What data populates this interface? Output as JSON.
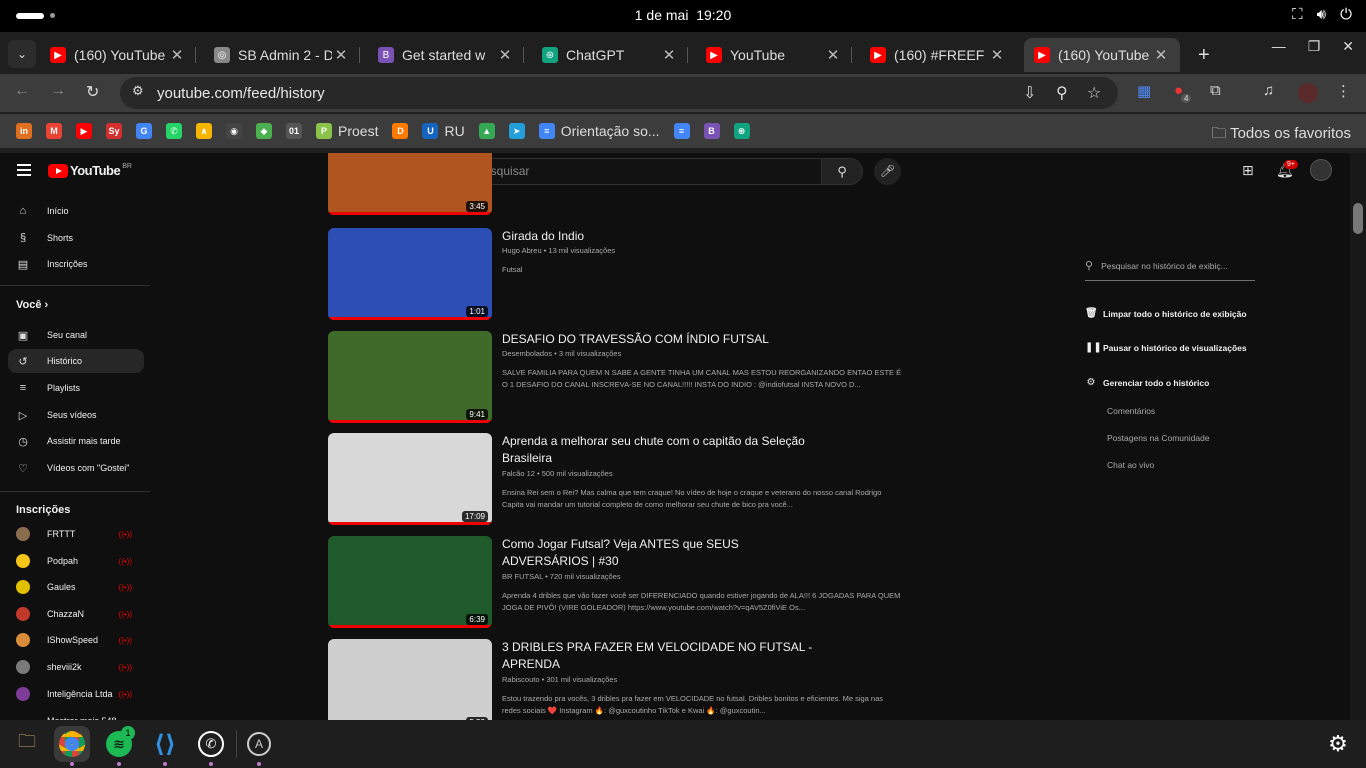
{
  "system": {
    "date": "1 de mai",
    "time": "19:20"
  },
  "tabs": [
    {
      "title": "(160) YouTube",
      "icon": "youtube-icon",
      "color": "#ff0000"
    },
    {
      "title": "SB Admin 2 - D",
      "icon": "globe-icon",
      "color": "#888888"
    },
    {
      "title": "Get started w",
      "icon": "bootstrap-icon",
      "color": "#7952b3"
    },
    {
      "title": "ChatGPT",
      "icon": "chatgpt-icon",
      "color": "#10a37f"
    },
    {
      "title": "YouTube",
      "icon": "youtube-icon",
      "color": "#ff0000"
    },
    {
      "title": "(160) #FREEF",
      "icon": "youtube-icon",
      "color": "#ff0000"
    },
    {
      "title": "(160) YouTube",
      "icon": "youtube-icon",
      "color": "#ff0000"
    }
  ],
  "address": {
    "url": "youtube.com/feed/history"
  },
  "extensions": {
    "badge_count": "4"
  },
  "bookmarks": [
    {
      "label": "",
      "glyph": "in",
      "color": "#e07020"
    },
    {
      "label": "",
      "glyph": "M",
      "color": "#ea4335"
    },
    {
      "label": "",
      "glyph": "▶",
      "color": "#ff0000"
    },
    {
      "label": "",
      "glyph": "Sy",
      "color": "#d32f2f"
    },
    {
      "label": "",
      "glyph": "G",
      "color": "#4285f4"
    },
    {
      "label": "",
      "glyph": "✆",
      "color": "#25d366"
    },
    {
      "label": "",
      "glyph": "∧",
      "color": "#f4b400"
    },
    {
      "label": "",
      "glyph": "◉",
      "color": "#444444"
    },
    {
      "label": "",
      "glyph": "◆",
      "color": "#4caf50"
    },
    {
      "label": "",
      "glyph": "01",
      "color": "#555555"
    },
    {
      "label": "Proest",
      "glyph": "P",
      "color": "#8bc34a"
    },
    {
      "label": "",
      "glyph": "D",
      "color": "#ff7a00"
    },
    {
      "label": "RU",
      "glyph": "U",
      "color": "#1565c0"
    },
    {
      "label": "",
      "glyph": "▲",
      "color": "#34a853"
    },
    {
      "label": "",
      "glyph": "➤",
      "color": "#229ed9"
    },
    {
      "label": "Orientação so...",
      "glyph": "≡",
      "color": "#4285f4"
    },
    {
      "label": "",
      "glyph": "≡",
      "color": "#4285f4"
    },
    {
      "label": "",
      "glyph": "B",
      "color": "#7952b3"
    },
    {
      "label": "",
      "glyph": "⊛",
      "color": "#10a37f"
    }
  ],
  "all_favorites": "Todos os favoritos",
  "youtube": {
    "logo_text": "YouTube",
    "region": "BR",
    "search_placeholder": "Pesquisar",
    "notifications": "9+"
  },
  "sidebar": {
    "main": [
      {
        "label": "Início",
        "icon": "home-icon",
        "glyph": "⌂"
      },
      {
        "label": "Shorts",
        "icon": "shorts-icon",
        "glyph": "§"
      },
      {
        "label": "Inscrições",
        "icon": "subscriptions-icon",
        "glyph": "▤"
      }
    ],
    "you_header": "Você",
    "you": [
      {
        "label": "Seu canal",
        "icon": "channel-icon",
        "glyph": "▣"
      },
      {
        "label": "Histórico",
        "icon": "history-icon",
        "glyph": "↺"
      },
      {
        "label": "Playlists",
        "icon": "playlists-icon",
        "glyph": "≡"
      },
      {
        "label": "Seus vídeos",
        "icon": "your-videos-icon",
        "glyph": "▷"
      },
      {
        "label": "Assistir mais tarde",
        "icon": "watch-later-icon",
        "glyph": "◷"
      },
      {
        "label": "Vídeos com \"Gostei\"",
        "icon": "like-icon",
        "glyph": "♡"
      }
    ],
    "subs_header": "Inscrições",
    "subs": [
      {
        "name": "FRTTT",
        "color": "#8a6d4f"
      },
      {
        "name": "Podpah",
        "color": "#f5c518"
      },
      {
        "name": "Gaules",
        "color": "#e0c000"
      },
      {
        "name": "ChazzaN",
        "color": "#c0392b"
      },
      {
        "name": "IShowSpeed",
        "color": "#d98c3a"
      },
      {
        "name": "sheviii2k",
        "color": "#7a7a7a"
      },
      {
        "name": "Inteligência Ltda",
        "color": "#7d3c98"
      }
    ],
    "show_more": "Mostrar mais 548"
  },
  "history": [
    {
      "title": "",
      "channel": "",
      "views": "",
      "desc": "",
      "duration": "3:45",
      "thumb": "#b0551f"
    },
    {
      "title": "Girada do Indio",
      "channel": "Hugo Abreu",
      "views": "13 mil visualizações",
      "desc": "Futsal",
      "duration": "1:01",
      "thumb": "#2d4fb5"
    },
    {
      "title": "DESAFIO DO TRAVESSÃO COM ÍNDIO FUTSAL",
      "channel": "Desembolados",
      "views": "3 mil visualizações",
      "desc": "SALVE FAMILIA PARA QUEM N SABE A GENTE TINHA UM CANAL MAS ESTOU REORGANIZANDO ENTAO ESTE É O 1 DESAFIO DO CANAL INSCREVA-SE NO CANAL!!!!! INSTA DO INDIO : @indiofutsal INSTA NOVO D...",
      "duration": "9:41",
      "thumb": "#3f6b2a"
    },
    {
      "title": "Aprenda a melhorar seu chute com o capitão da Seleção Brasileira",
      "channel": "Falcão 12",
      "views": "500 mil visualizações",
      "desc": "Ensina Rei sem o Rei? Mas calma que tem craque! No vídeo de hoje o craque e veterano do nosso canal Rodrigo Capita vai mandar um tutorial completo de como melhorar seu chute de bico pra você...",
      "duration": "17:09",
      "thumb": "#d8d8d8"
    },
    {
      "title": "Como Jogar Futsal? Veja ANTES que SEUS ADVERSÁRIOS | #30",
      "channel": "BR FUTSAL",
      "views": "720 mil visualizações",
      "desc": "Aprenda 4 dribles que vão fazer você ser DIFERENCIADO quando estiver jogando de ALA!!! 6 JOGADAS PARA QUEM JOGA DE PIVÔ! (VIRE GOLEADOR) https://www.youtube.com/watch?v=qAV5Z0fiViE Os...",
      "duration": "6:39",
      "thumb": "#1f5a2a"
    },
    {
      "title": "3 DRIBLES PRA FAZER EM VELOCIDADE NO FUTSAL - APRENDA",
      "channel": "Rabiscouto",
      "views": "301 mil visualizações",
      "desc": "Estou trazendo pra vocês, 3 dribles pra fazer em VELOCIDADE no futsal. Dribles bonitos e eficientes. Me siga nas redes sociais ❤️ Instagram 🔥: @guxcoutinho TikTok e Kwai 🔥: @guxcoutin...",
      "duration": "5:52",
      "thumb": "#cfcfcf"
    }
  ],
  "right_panel": {
    "search_placeholder": "Pesquisar no histórico de exibiç...",
    "clear": "Limpar todo o histórico de exibição",
    "pause": "Pausar o histórico de visualizações",
    "manage": "Gerenciar todo o histórico",
    "comments": "Comentários",
    "community": "Postagens na Comunidade",
    "live_chat": "Chat ao vivo"
  },
  "dock": {
    "spotify_badge": "1"
  }
}
